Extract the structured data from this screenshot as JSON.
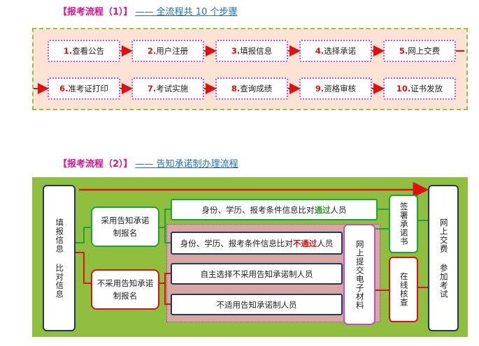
{
  "section1": {
    "bracket": "【报考流程（1）】",
    "link": "—— 全流程共 10 个步骤"
  },
  "steps": [
    {
      "num": "1.",
      "label": "查看公告"
    },
    {
      "num": "2.",
      "label": "用户注册"
    },
    {
      "num": "3.",
      "label": "填报信息"
    },
    {
      "num": "4.",
      "label": "选择承诺"
    },
    {
      "num": "5.",
      "label": "网上交费"
    },
    {
      "num": "6.",
      "label": "准考证打印"
    },
    {
      "num": "7.",
      "label": "考试实施"
    },
    {
      "num": "8.",
      "label": "查询成绩"
    },
    {
      "num": "9.",
      "label": "资格审核"
    },
    {
      "num": "10.",
      "label": "证书发放"
    }
  ],
  "section2": {
    "bracket": "【报考流程（2）】",
    "link": "—— 告知承诺制办理流程"
  },
  "flow2": {
    "fill_compare": "填报信息 比对信息",
    "use_promise": "采用告知承诺制报名",
    "no_promise": "不采用告知承诺制报名",
    "pass_pre": "身份、学历、报考条件信息比对",
    "pass_word": "通过",
    "pass_post": "人员",
    "fail_pre": "身份、学历、报考条件信息比对",
    "fail_word": "不通过",
    "fail_post": "人员",
    "self_choose": "自主选择不采用告知承诺制人员",
    "not_applicable": "不适用告知承诺制人员",
    "submit_materials": "网上提交电子材料",
    "sign_letter": "签署承诺书",
    "online_check": "在线核查",
    "pay_exam": "网上交费 参加考试"
  },
  "colors": {
    "arrow_red": "#e01010",
    "green": "#1fa23a",
    "panel1_bg": "#fce3d3",
    "panel2_bg": "#8fbf3f",
    "magenta": "#e0128e",
    "link_blue": "#1f6fb5"
  }
}
